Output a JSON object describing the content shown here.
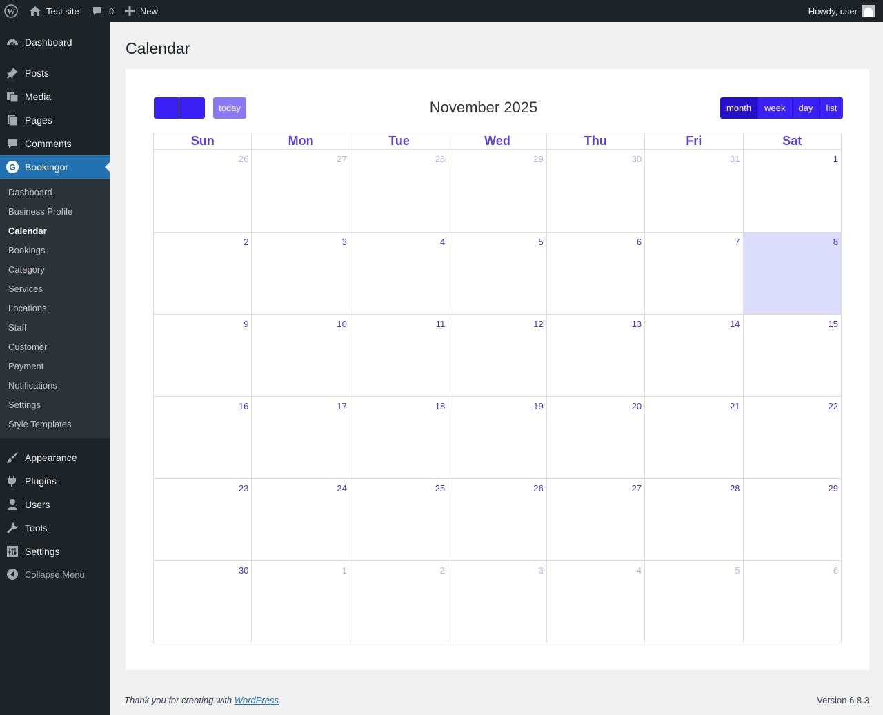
{
  "adminbar": {
    "site_name": "Test site",
    "comments_count": "0",
    "new_label": "New",
    "howdy": "Howdy, user"
  },
  "sidebar": {
    "items_top": [
      {
        "label": "Dashboard",
        "icon": "dashboard-icon"
      },
      {
        "label": "Posts",
        "icon": "pin-icon"
      },
      {
        "label": "Media",
        "icon": "media-icon"
      },
      {
        "label": "Pages",
        "icon": "pages-icon"
      },
      {
        "label": "Comments",
        "icon": "comment-icon"
      },
      {
        "label": "Bookingor",
        "icon": "bookingor-icon"
      }
    ],
    "submenu": [
      "Dashboard",
      "Business Profile",
      "Calendar",
      "Bookings",
      "Category",
      "Services",
      "Locations",
      "Staff",
      "Customer",
      "Payment",
      "Notifications",
      "Settings",
      "Style Templates"
    ],
    "submenu_current": "Calendar",
    "items_bottom": [
      {
        "label": "Appearance",
        "icon": "brush-icon"
      },
      {
        "label": "Plugins",
        "icon": "plugin-icon"
      },
      {
        "label": "Users",
        "icon": "users-icon"
      },
      {
        "label": "Tools",
        "icon": "wrench-icon"
      },
      {
        "label": "Settings",
        "icon": "settings-icon"
      }
    ],
    "collapse_label": "Collapse Menu"
  },
  "page": {
    "title": "Calendar"
  },
  "calendar": {
    "today_label": "today",
    "title": "November 2025",
    "views": [
      "month",
      "week",
      "day",
      "list"
    ],
    "active_view": "month",
    "weekdays": [
      "Sun",
      "Mon",
      "Tue",
      "Wed",
      "Thu",
      "Fri",
      "Sat"
    ],
    "weeks": [
      [
        {
          "d": "26",
          "o": true
        },
        {
          "d": "27",
          "o": true
        },
        {
          "d": "28",
          "o": true
        },
        {
          "d": "29",
          "o": true
        },
        {
          "d": "30",
          "o": true
        },
        {
          "d": "31",
          "o": true
        },
        {
          "d": "1"
        }
      ],
      [
        {
          "d": "2"
        },
        {
          "d": "3"
        },
        {
          "d": "4"
        },
        {
          "d": "5"
        },
        {
          "d": "6"
        },
        {
          "d": "7"
        },
        {
          "d": "8",
          "today": true
        }
      ],
      [
        {
          "d": "9"
        },
        {
          "d": "10"
        },
        {
          "d": "11"
        },
        {
          "d": "12"
        },
        {
          "d": "13"
        },
        {
          "d": "14"
        },
        {
          "d": "15"
        }
      ],
      [
        {
          "d": "16"
        },
        {
          "d": "17"
        },
        {
          "d": "18"
        },
        {
          "d": "19"
        },
        {
          "d": "20"
        },
        {
          "d": "21"
        },
        {
          "d": "22"
        }
      ],
      [
        {
          "d": "23"
        },
        {
          "d": "24"
        },
        {
          "d": "25"
        },
        {
          "d": "26"
        },
        {
          "d": "27"
        },
        {
          "d": "28"
        },
        {
          "d": "29"
        }
      ],
      [
        {
          "d": "30"
        },
        {
          "d": "1",
          "o": true
        },
        {
          "d": "2",
          "o": true
        },
        {
          "d": "3",
          "o": true
        },
        {
          "d": "4",
          "o": true
        },
        {
          "d": "5",
          "o": true
        },
        {
          "d": "6",
          "o": true
        }
      ]
    ],
    "colors": {
      "primary": "#3a20f5",
      "today_button": "#8b78f4",
      "today_cell": "#dcdcfb",
      "weekday_text": "#5b3fd9"
    }
  },
  "footer": {
    "thanks_prefix": "Thank you for creating with ",
    "thanks_link": "WordPress",
    "thanks_suffix": ".",
    "version": "Version 6.8.3"
  }
}
